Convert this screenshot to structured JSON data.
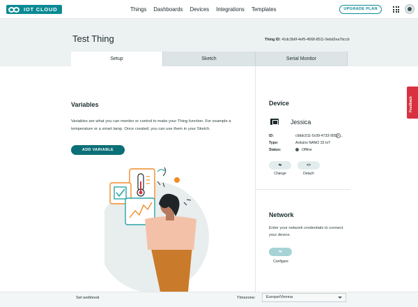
{
  "brand": {
    "logo_text": "IOT CLOUD"
  },
  "nav": {
    "items": [
      "Things",
      "Dashboards",
      "Devices",
      "Integrations",
      "Templates"
    ]
  },
  "header": {
    "upgrade_label": "UPGRADE PLAN"
  },
  "thing": {
    "title": "Test Thing",
    "id_label": "Thing ID:",
    "id_value": "41dc3b6f-4ef5-4568-8511-9ebd2ea7bccb"
  },
  "tabs": [
    {
      "label": "Setup",
      "active": true
    },
    {
      "label": "Sketch",
      "active": false
    },
    {
      "label": "Serial Monitor",
      "active": false
    }
  ],
  "variables": {
    "title": "Variables",
    "description": "Variables are what you can monitor or control to make your Thing function. For example a temperature or a smart lamp. Once created, you can use them in your Sketch.",
    "add_button": "ADD VARIABLE"
  },
  "device": {
    "title": "Device",
    "name": "Jessica",
    "id_key": "ID:",
    "id_value": "c9ddc511-5c99-4733-9559-...",
    "type_key": "Type:",
    "type_value": "Arduino NANO 33 IoT",
    "status_key": "Status:",
    "status_value": "Offline",
    "change_label": "Change",
    "detach_label": "Detach",
    "change_icon_text": "⇆",
    "detach_icon_text": "<>"
  },
  "network": {
    "title": "Network",
    "description": "Enter your network credentials to connect your device.",
    "configure_label": "Configure",
    "configure_icon_text": "⇆"
  },
  "feedback": {
    "label": "Feedback"
  },
  "footer": {
    "webhook_label": "Set webhook",
    "timezone_label": "Timezone:",
    "timezone_value": "Europe/Vienna"
  },
  "colors": {
    "accent": "#0b8a95",
    "primary_button": "#0b6f78",
    "header_bg": "#ecf1f1",
    "feedback": "#d83242",
    "illustration_circle": "#e8eded",
    "illustration_orange": "#f28c28",
    "illustration_teal": "#2aa4a8"
  }
}
